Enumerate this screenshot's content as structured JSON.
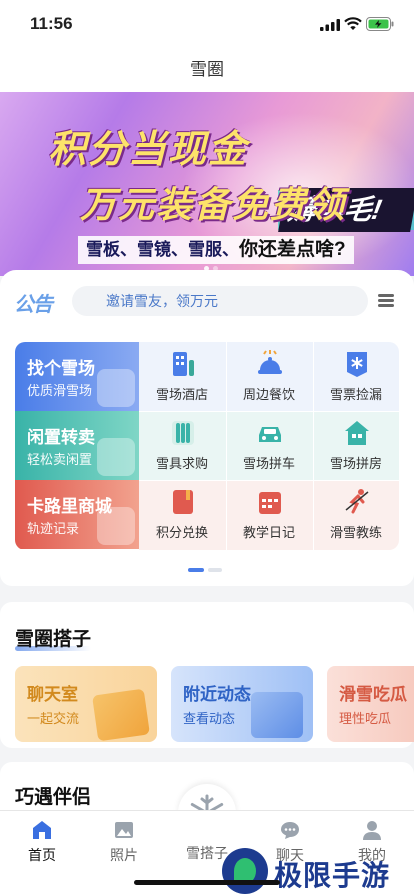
{
  "status": {
    "time": "11:56"
  },
  "nav": {
    "title": "雪圈"
  },
  "banner": {
    "line1": "积分当现金",
    "line2": "万元装备免费领",
    "slogan": "薅羊毛!",
    "tagline_a": "雪板、雪镜、雪服、",
    "tagline_b": "你还差点啥?"
  },
  "notice": {
    "logo_text": "公告",
    "placeholder": "邀请雪友，领万元"
  },
  "features": [
    {
      "title": "找个雪场",
      "subtitle": "优质滑雪场"
    },
    {
      "title": "闲置转卖",
      "subtitle": "轻松卖闲置"
    },
    {
      "title": "卡路里商城",
      "subtitle": "轨迹记录"
    }
  ],
  "services": [
    {
      "label": "雪场酒店",
      "icon": "hotel-icon",
      "color": "#4a7de8"
    },
    {
      "label": "周边餐饮",
      "icon": "dining-icon",
      "color": "#4a7de8"
    },
    {
      "label": "雪票捡漏",
      "icon": "ticket-icon",
      "color": "#4a7de8"
    },
    {
      "label": "雪具求购",
      "icon": "ski-gear-icon",
      "color": "#39b3a8"
    },
    {
      "label": "雪场拼车",
      "icon": "car-icon",
      "color": "#39b3a8"
    },
    {
      "label": "雪场拼房",
      "icon": "house-icon",
      "color": "#39b3a8"
    },
    {
      "label": "积分兑换",
      "icon": "book-icon",
      "color": "#e05a4f"
    },
    {
      "label": "教学日记",
      "icon": "calendar-icon",
      "color": "#e05a4f"
    },
    {
      "label": "滑雪教练",
      "icon": "skier-icon",
      "color": "#e05a4f"
    }
  ],
  "group_section": {
    "title": "雪圈搭子",
    "tiles": [
      {
        "title": "聊天室",
        "subtitle": "一起交流"
      },
      {
        "title": "附近动态",
        "subtitle": "查看动态"
      },
      {
        "title": "滑雪吃瓜",
        "subtitle": "理性吃瓜"
      }
    ]
  },
  "next_section": {
    "title": "巧遇伴侣"
  },
  "tabbar": {
    "items": [
      {
        "label": "首页",
        "icon": "home-icon"
      },
      {
        "label": "照片",
        "icon": "photo-icon"
      },
      {
        "label": "雪搭子",
        "icon": "snowflake-icon"
      },
      {
        "label": "聊天",
        "icon": "chat-icon"
      },
      {
        "label": "我的",
        "icon": "profile-icon"
      }
    ]
  },
  "watermark": {
    "text": "极限手游网"
  }
}
